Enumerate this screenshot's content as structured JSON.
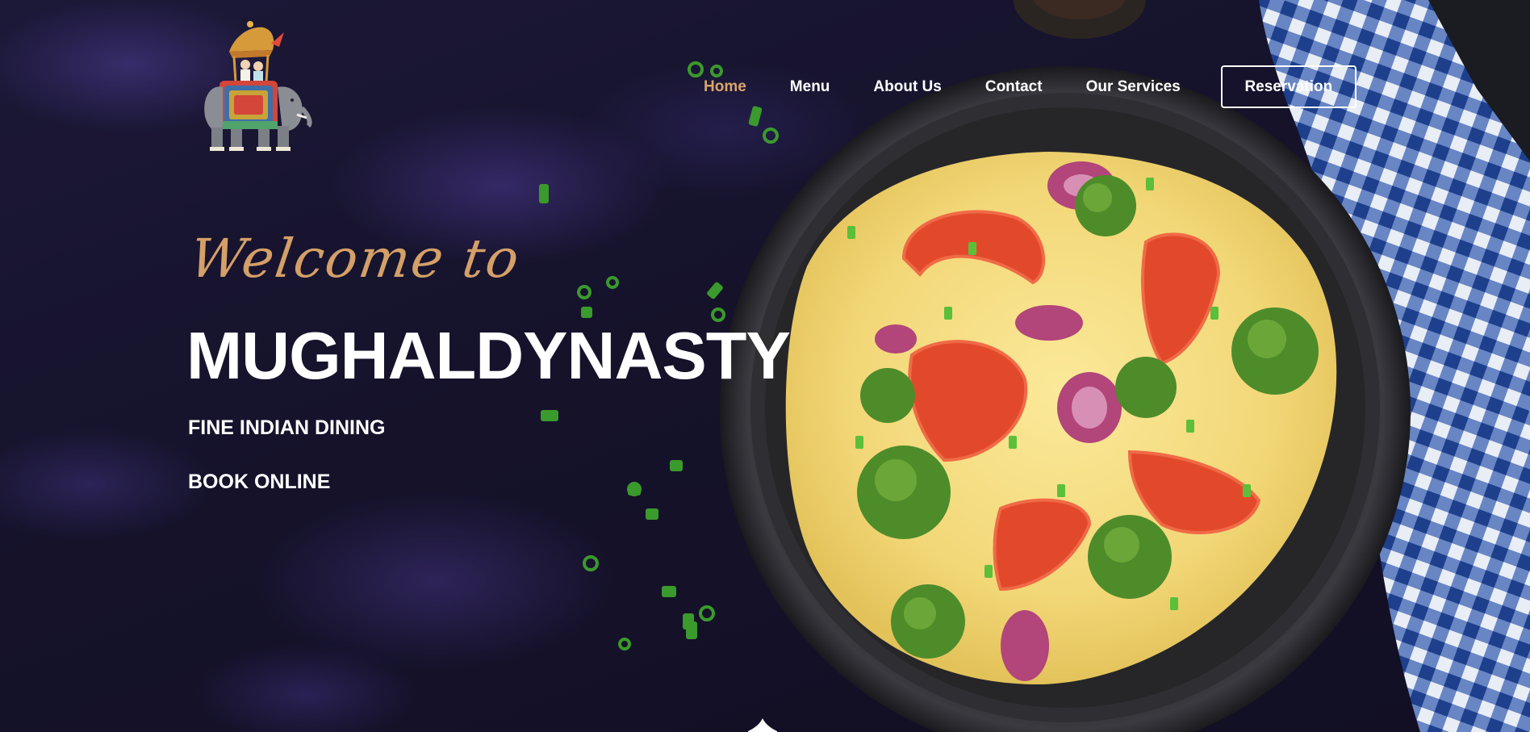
{
  "nav": {
    "items": [
      {
        "label": "Home",
        "active": true
      },
      {
        "label": "Menu",
        "active": false
      },
      {
        "label": "About Us",
        "active": false
      },
      {
        "label": "Contact",
        "active": false
      },
      {
        "label": "Our Services",
        "active": false
      }
    ],
    "reservation_label": "Reservation"
  },
  "hero": {
    "welcome": "Welcome to",
    "brand": "MUGHALDYNASTY",
    "tagline": "FINE INDIAN DINING",
    "book_link": "BOOK ONLINE"
  },
  "icons": {
    "logo": "elephant-with-howdah-logo",
    "scroll": "scroll-down-icon"
  },
  "colors": {
    "background": "#15122a",
    "accent": "#d9a66b",
    "text": "#ffffff",
    "cloth_blue": "#2a4f9e"
  }
}
